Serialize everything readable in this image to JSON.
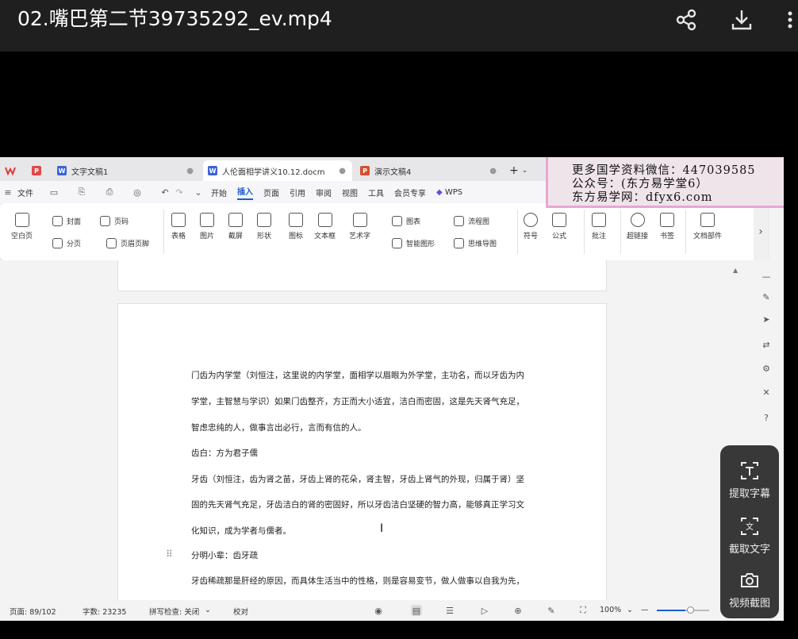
{
  "player": {
    "title": "02.嘴巴第二节39735292_ev.mp4",
    "icons": [
      "share-icon",
      "download-icon",
      "more-icon"
    ]
  },
  "wps": {
    "tabs": [
      {
        "label": "文字文稿1",
        "type": "W",
        "color": "#3b63d9"
      },
      {
        "label": "人伦面相学讲义10.12.docm",
        "type": "W",
        "color": "#3b63d9"
      },
      {
        "label": "演示文稿4",
        "type": "P",
        "color": "#d3502f"
      }
    ],
    "menu": {
      "file": "文件",
      "items": [
        "开始",
        "插入",
        "页面",
        "引用",
        "审阅",
        "视图",
        "工具",
        "会员专享"
      ],
      "active": "插入",
      "wps_ai": "WPS"
    },
    "ribbon": {
      "blank_page": "空白页",
      "cover": "封面",
      "page_break": "分页",
      "page_number": "页码",
      "header_footer": "页眉页脚",
      "table": "表格",
      "picture": "图片",
      "screenshot": "截屏",
      "shape": "形状",
      "icon": "图标",
      "textbox": "文本框",
      "wordart": "艺术字",
      "chart": "图表",
      "smart_graphic": "智能图形",
      "flowchart": "流程图",
      "mindmap": "思维导图",
      "symbol": "符号",
      "formula": "公式",
      "comment": "批注",
      "hyperlink": "超链接",
      "bookmark": "书签",
      "doc_parts": "文档部件"
    },
    "document": {
      "lines": [
        "门齿为内学堂（刘恒注，这里说的内学堂，面相学以眉眼为外学堂，主功名，而以牙齿为内",
        "学堂，主智慧与学识）如果门齿整齐，方正而大小适宜，洁白而密固，这是先天肾气充足，",
        "智虑忠纯的人，做事言出必行，言而有信的人。",
        "齿白：方为君子儒",
        "牙齿（刘恒注，齿为肾之苗，牙齿上肾的花朵，肾主智，牙齿上肾气的外现，归属于肾）坚",
        "固的先天肾气充足，牙齿洁白的肾的密固好，所以牙齿洁白坚硬的智力高，能够真正学习文",
        "化知识，成为学者与儒者。",
        "分明小辈：齿牙疏",
        "牙齿稀疏那是肝经的原因，而具体生活当中的性格，则是容易变节，做人做事以自我为先，"
      ]
    },
    "status": {
      "page": "页面: 89/102",
      "words": "字数: 23235",
      "spell": "拼写检查: 关闭",
      "proofread": "校对",
      "zoom": "100%",
      "zoom_level_percent": 55
    }
  },
  "watermark": {
    "lines": [
      "更多国学资料微信：447039585",
      "公众号：(东方易学堂6）",
      "东方易学网：dfyx6.com"
    ]
  },
  "float_panel": {
    "items": [
      "提取字幕",
      "截取文字",
      "视频截图"
    ]
  }
}
